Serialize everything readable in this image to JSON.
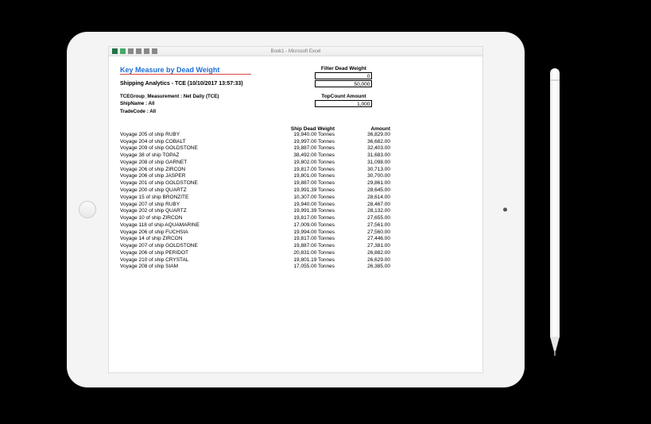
{
  "titlebar": {
    "app_title": "Book1 - Microsoft Excel"
  },
  "report": {
    "title": "Key Measure by Dead Weight",
    "subtitle": "Shipping Analytics - TCE (10/10/2017 13:57:33)",
    "meta_measurement": "TCEGroup_Measurement : Net Daily (TCE)",
    "meta_shipname": "ShipName : All",
    "meta_tradecode": "TradeCode : All"
  },
  "filters": {
    "deadweight_label": "Filter Dead Weight",
    "deadweight_min": "0",
    "deadweight_max": "50,000",
    "topcount_label": "TopCount Amount",
    "topcount_value": "1,000"
  },
  "columns": {
    "col1": "",
    "col2": "Ship Dead Weight",
    "col3": "Amount"
  },
  "rows": [
    {
      "desc": "Voyage 205 of ship RUBY",
      "dw": "19,940.00 Tonnes",
      "amt": "36,829.00"
    },
    {
      "desc": "Voyage 204 of ship COBALT",
      "dw": "19,997.00 Tonnes",
      "amt": "36,682.00"
    },
    {
      "desc": "Voyage 209 of ship GOLDSTONE",
      "dw": "19,887.00 Tonnes",
      "amt": "32,403.00"
    },
    {
      "desc": "Voyage 38 of ship TOPAZ",
      "dw": "38,492.00 Tonnes",
      "amt": "31,683.00"
    },
    {
      "desc": "Voyage 208 of ship GARNET",
      "dw": "19,802.00 Tonnes",
      "amt": "31,098.00"
    },
    {
      "desc": "Voyage 206 of ship ZIRCON",
      "dw": "19,817.00 Tonnes",
      "amt": "30,713.00"
    },
    {
      "desc": "Voyage 206 of ship JASPER",
      "dw": "19,801.00 Tonnes",
      "amt": "30,700.00"
    },
    {
      "desc": "Voyage 201 of ship GOLDSTONE",
      "dw": "19,887.00 Tonnes",
      "amt": "29,861.00"
    },
    {
      "desc": "Voyage 200 of ship QUARTZ",
      "dw": "19,991.39 Tonnes",
      "amt": "28,645.00"
    },
    {
      "desc": "Voyage 15 of ship BRONZITE",
      "dw": "10,307.00 Tonnes",
      "amt": "28,614.00"
    },
    {
      "desc": "Voyage 207 of ship RUBY",
      "dw": "19,940.00 Tonnes",
      "amt": "28,467.00"
    },
    {
      "desc": "Voyage 202 of ship QUARTZ",
      "dw": "19,991.39 Tonnes",
      "amt": "28,132.00"
    },
    {
      "desc": "Voyage 10 of ship ZIRCON",
      "dw": "19,817.00 Tonnes",
      "amt": "27,655.00"
    },
    {
      "desc": "Voyage 118 of ship AQUAMARINE",
      "dw": "17,009.00 Tonnes",
      "amt": "27,561.00"
    },
    {
      "desc": "Voyage 206 of ship FUCHSIA",
      "dw": "19,994.00 Tonnes",
      "amt": "27,560.00"
    },
    {
      "desc": "Voyage 14 of ship ZIRCON",
      "dw": "19,817.00 Tonnes",
      "amt": "27,446.00"
    },
    {
      "desc": "Voyage 207 of ship GOLDSTONE",
      "dw": "19,887.00 Tonnes",
      "amt": "27,381.00"
    },
    {
      "desc": "Voyage 206 of ship PERIDOT",
      "dw": "20,831.00 Tonnes",
      "amt": "26,882.00"
    },
    {
      "desc": "Voyage 210 of ship CRYSTAL",
      "dw": "19,801.19 Tonnes",
      "amt": "26,629.00"
    },
    {
      "desc": "Voyage 208 of ship SIAM",
      "dw": "17,055.00 Tonnes",
      "amt": "26,385.00"
    }
  ]
}
